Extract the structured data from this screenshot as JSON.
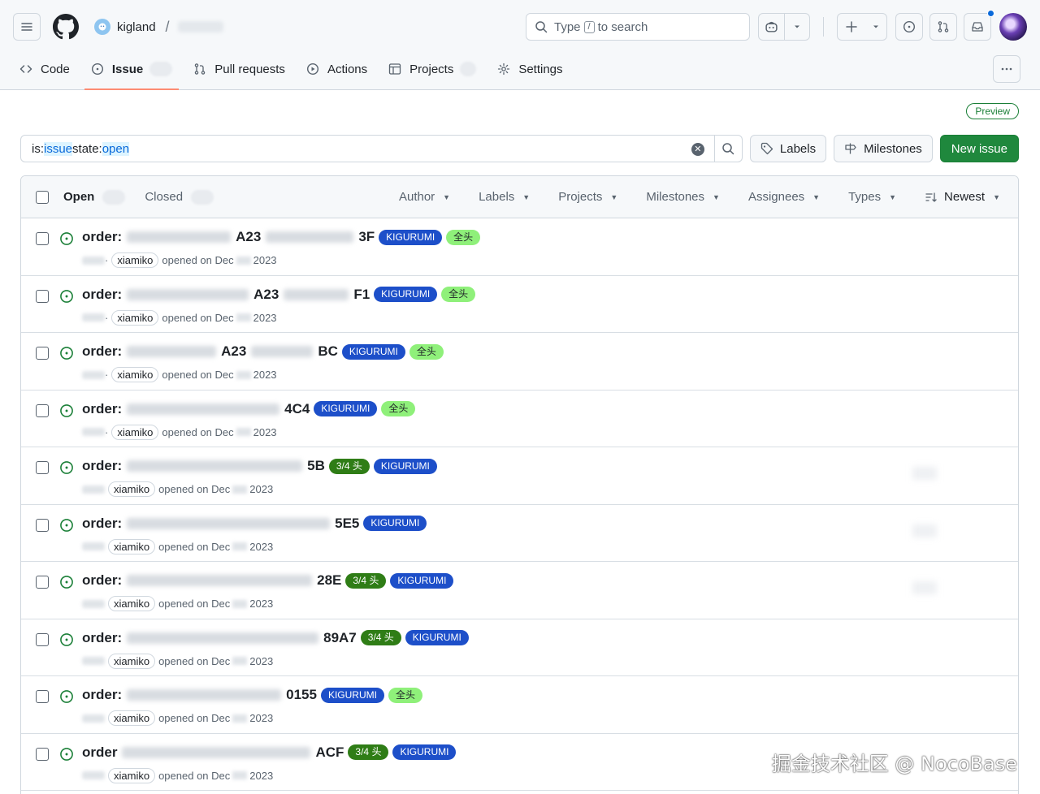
{
  "header": {
    "owner": "kigland",
    "slash": "/",
    "search": {
      "prefix": "Type",
      "key": "/",
      "suffix": "to search"
    }
  },
  "tabs": [
    {
      "label": "Code"
    },
    {
      "label": "Issue"
    },
    {
      "label": "Pull requests"
    },
    {
      "label": "Actions"
    },
    {
      "label": "Projects"
    },
    {
      "label": "Settings"
    }
  ],
  "preview_badge": "Preview",
  "filter": {
    "p1": "is:",
    "v1": "issue",
    "p2": " state:",
    "v2": "open",
    "labels_button": "Labels",
    "milestones_button": "Milestones",
    "new_issue_button": "New issue"
  },
  "list_header": {
    "open": "Open",
    "closed": "Closed",
    "filters": [
      "Author",
      "Labels",
      "Projects",
      "Milestones",
      "Assignees",
      "Types",
      "Newest"
    ]
  },
  "common": {
    "author": "xiamiko",
    "opened": "opened on Dec",
    "year": "2023",
    "kig": "KIGURUMI",
    "full": "全头",
    "tq": "3/4 头"
  },
  "issues": [
    {
      "prefix": "order:",
      "mid": "A23",
      "suffix": "3F"
    },
    {
      "prefix": "order:",
      "mid": "A23",
      "suffix": "F1"
    },
    {
      "prefix": "order:",
      "mid": "A23",
      "suffix": "BC"
    },
    {
      "prefix": "order:",
      "mid": "",
      "suffix": "4C4"
    },
    {
      "prefix": "order:",
      "mid": "",
      "suffix": "5B"
    },
    {
      "prefix": "order:",
      "mid": "",
      "suffix": "5E5"
    },
    {
      "prefix": "order:",
      "mid": "",
      "suffix": "28E"
    },
    {
      "prefix": "order:",
      "mid": "",
      "suffix": "89A7"
    },
    {
      "prefix": "order:",
      "mid": "",
      "suffix": "0155"
    },
    {
      "prefix": "order",
      "mid": "",
      "suffix": "ACF"
    }
  ],
  "watermark": "掘金技术社区 @ NocoBase",
  "colors": {
    "kigurumi_label": "#1d4fc9",
    "full_head_label": "#8ff07a",
    "three_quarter_label": "#2f7d16",
    "primary_button": "#1f883d",
    "open_icon": "#1a7f37",
    "tab_underline": "#fd8c73"
  }
}
